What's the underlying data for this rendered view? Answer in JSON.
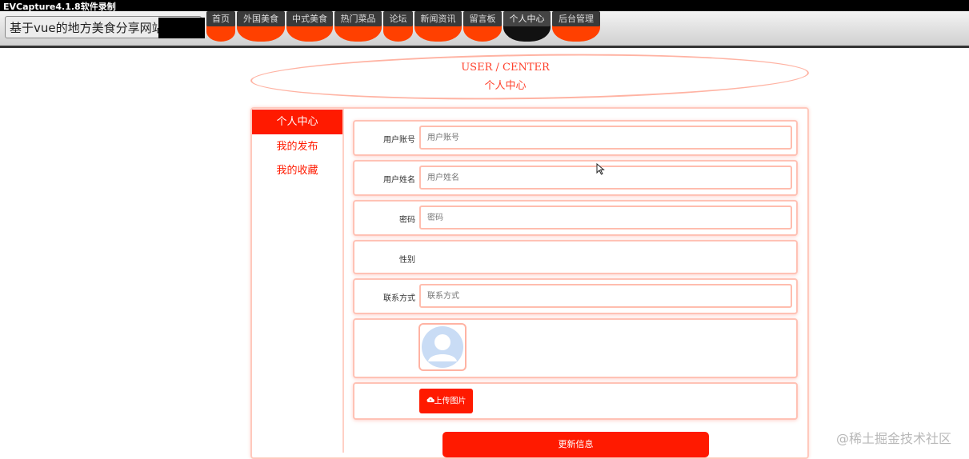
{
  "recorder": {
    "title": "EVCapture4.1.8软件录制"
  },
  "header": {
    "site_title": "基于vue的地方美食分享网站"
  },
  "nav": [
    {
      "label": "首页",
      "width": 36,
      "active": false
    },
    {
      "label": "外国美食",
      "width": 60,
      "active": false
    },
    {
      "label": "中式美食",
      "width": 58,
      "active": false
    },
    {
      "label": "热门菜品",
      "width": 59,
      "active": false
    },
    {
      "label": "论坛",
      "width": 37,
      "active": false
    },
    {
      "label": "新闻资讯",
      "width": 59,
      "active": false
    },
    {
      "label": "留言板",
      "width": 48,
      "active": false
    },
    {
      "label": "个人中心",
      "width": 59,
      "active": true
    },
    {
      "label": "后台管理",
      "width": 60,
      "active": false
    }
  ],
  "banner": {
    "title_en": "USER / CENTER",
    "title_cn": "个人中心"
  },
  "sidebar": {
    "active": "个人中心",
    "items": [
      "我的发布",
      "我的收藏"
    ]
  },
  "form": {
    "username": {
      "label": "用户账号",
      "placeholder": "用户账号"
    },
    "name": {
      "label": "用户姓名",
      "placeholder": "用户姓名"
    },
    "password": {
      "label": "密码",
      "placeholder": "密码"
    },
    "gender": {
      "label": "性别"
    },
    "contact": {
      "label": "联系方式",
      "placeholder": "联系方式"
    },
    "upload_label": "上传图片",
    "submit_label": "更新信息"
  },
  "watermark": "@稀土掘金技术社区",
  "colors": {
    "accent": "#ff1a00",
    "nav_tab": "#ff4000",
    "border": "#ffc2b5"
  }
}
